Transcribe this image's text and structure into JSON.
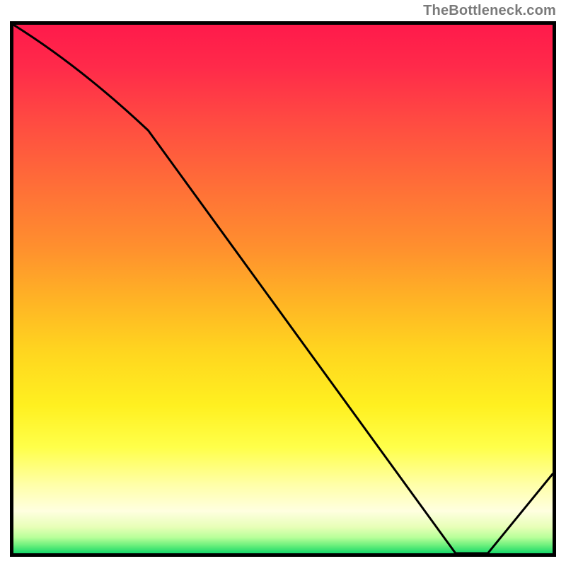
{
  "attribution": "TheBottleneck.com",
  "floor_label": "",
  "chart_data": {
    "type": "line",
    "title": "",
    "xlabel": "",
    "ylabel": "",
    "xlim": [
      0,
      100
    ],
    "ylim": [
      0,
      100
    ],
    "series": [
      {
        "name": "curve",
        "x": [
          0,
          25,
          82,
          88,
          100
        ],
        "values": [
          100,
          80,
          0,
          0,
          15
        ]
      }
    ],
    "annotations": [
      {
        "text": "",
        "x": 84,
        "y": 1.5
      }
    ],
    "background": "vertical-gradient-red-to-green"
  }
}
